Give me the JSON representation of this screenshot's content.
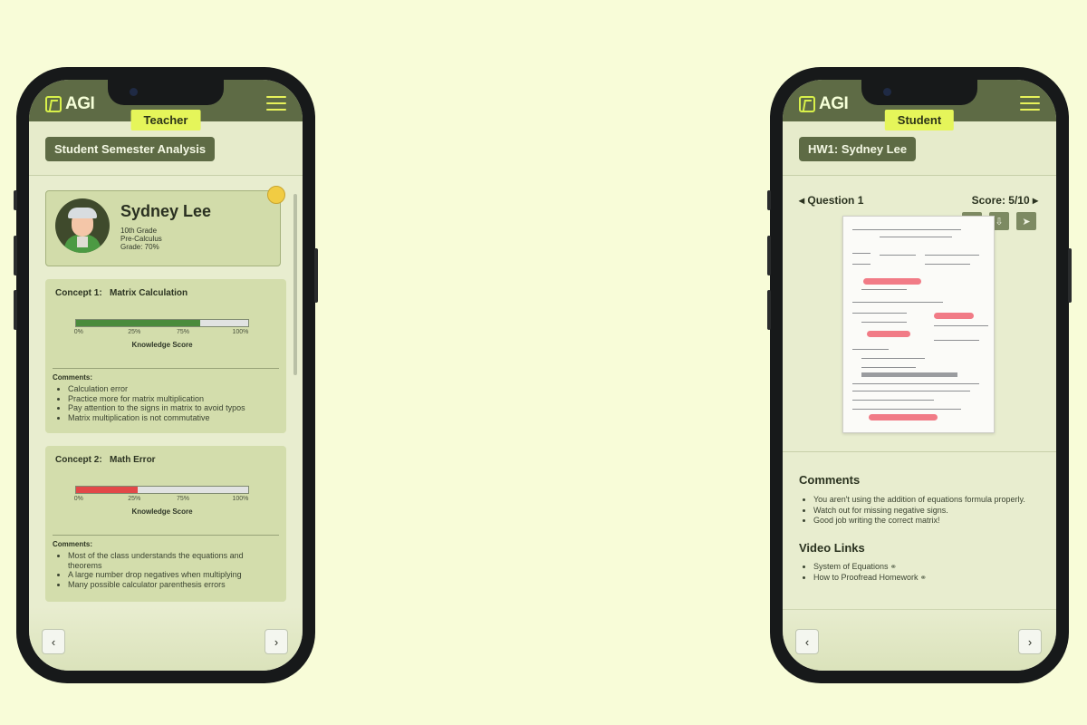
{
  "brand": {
    "name": "AGI"
  },
  "teacher": {
    "role_tag": "Teacher",
    "page_title": "Student Semester Analysis",
    "student": {
      "name": "Sydney Lee",
      "grade_level": "10th Grade",
      "course": "Pre-Calculus",
      "grade": "Grade: 70%"
    },
    "concepts": [
      {
        "number_label": "Concept 1:",
        "name": "Matrix Calculation",
        "score_fraction": 0.72,
        "score_color": "#4a8b3c",
        "ticks": [
          "0%",
          "25%",
          "75%",
          "100%"
        ],
        "score_label": "Knowledge Score",
        "comments_label": "Comments:",
        "comments": [
          "Calculation error",
          "Practice more for matrix multiplication",
          "Pay attention to the signs in matrix to avoid typos",
          "Matrix multiplication is not commutative"
        ]
      },
      {
        "number_label": "Concept 2:",
        "name": "Math Error",
        "score_fraction": 0.36,
        "score_color": "#e24848",
        "ticks": [
          "0%",
          "25%",
          "75%",
          "100%"
        ],
        "score_label": "Knowledge Score",
        "comments_label": "Comments:",
        "comments": [
          "Most of the class understands the equations and theorems",
          "A large number drop negatives when multiplying",
          "Many possible calculator parenthesis errors"
        ]
      }
    ],
    "nav": {
      "prev": "‹",
      "next": "›"
    }
  },
  "student_view": {
    "role_tag": "Student",
    "page_title": "HW1: Sydney Lee",
    "question_label": "Question 1",
    "score_label": "Score: 5/10",
    "tools": [
      {
        "name": "expand-icon",
        "glyph": "⛶"
      },
      {
        "name": "download-icon",
        "glyph": "⇩"
      },
      {
        "name": "send-icon",
        "glyph": "➤"
      }
    ],
    "comments_heading": "Comments",
    "comments": [
      "You aren't using the addition of equations formula properly.",
      "Watch out for missing negative signs.",
      "Good job writing the correct matrix!"
    ],
    "video_heading": "Video Links",
    "videos": [
      "System of Equations",
      "How to Proofread Homework"
    ],
    "nav": {
      "prev": "‹",
      "next": "›"
    }
  },
  "colors": {
    "background": "#f8fcd8",
    "appbar": "#5e6b45",
    "role_tag": "#e5f55a",
    "card": "#d3ddac"
  }
}
